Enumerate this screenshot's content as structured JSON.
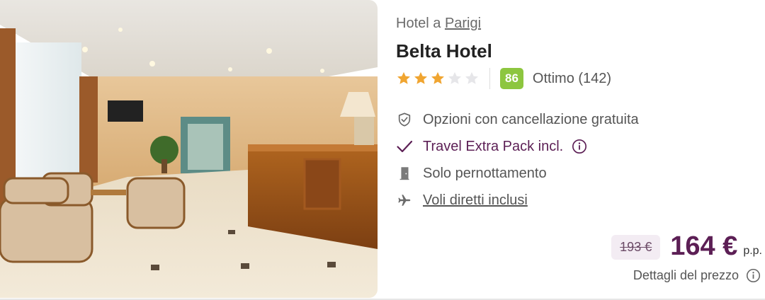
{
  "location": {
    "prefix": "Hotel a",
    "city": "Parigi"
  },
  "hotel": {
    "name": "Belta Hotel"
  },
  "rating": {
    "stars": 3,
    "max_stars": 5,
    "score": "86",
    "label": "Ottimo (142)"
  },
  "features": [
    {
      "icon": "shield-check-icon",
      "text": "Opzioni con cancellazione gratuita"
    },
    {
      "icon": "checkmark-icon",
      "text": "Travel Extra Pack incl."
    },
    {
      "icon": "door-icon",
      "text": "Solo pernottamento"
    },
    {
      "icon": "airplane-icon",
      "text": "Voli diretti inclusi"
    }
  ],
  "price": {
    "old": "193 €",
    "new": "164 €",
    "unit": "p.p.",
    "details_label": "Dettagli del prezzo"
  },
  "colors": {
    "accent": "#5c1f55",
    "star": "#f0a531",
    "score_badge": "#8dc63f"
  }
}
